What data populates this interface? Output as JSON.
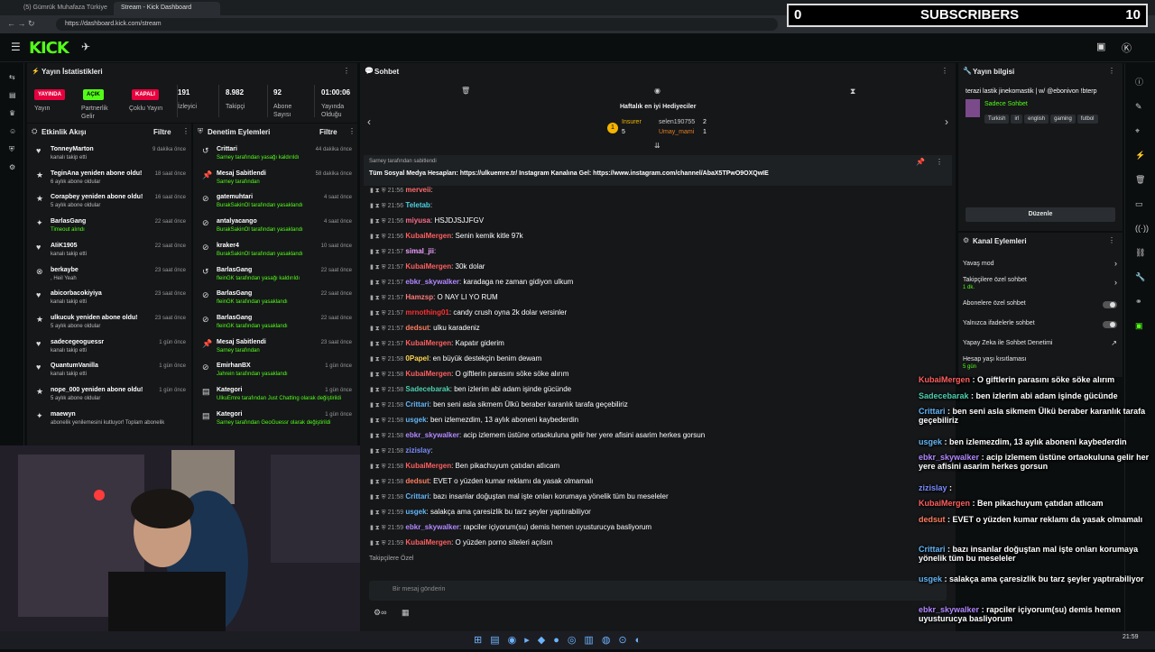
{
  "browser": {
    "tabs": [
      "(5) Gümrük Muhafaza Türkiye 10...",
      "Stream - Kick Dashboard"
    ],
    "url": "https://dashboard.kick.com/stream"
  },
  "overlay_subs": {
    "left": "0",
    "label": "SUBSCRIBERS",
    "right": "10"
  },
  "logo": "KICK",
  "stats": {
    "title": "Yayın İstatistikleri",
    "badges": [
      "YAYINDA",
      "AÇIK",
      "KAPALI"
    ],
    "badge_labels": [
      "Yayın",
      "Partnerlik Gelir",
      "Çoklu Yayın"
    ],
    "items": [
      {
        "value": "191",
        "label": "İzleyici"
      },
      {
        "value": "8.982",
        "label": "Takipçi"
      },
      {
        "value": "92",
        "label": "Abone Sayısı"
      },
      {
        "value": "01:00:06",
        "label": "Yayında Olduğu"
      }
    ]
  },
  "feed": {
    "title": "Etkinlik Akışı",
    "filter": "Filtre",
    "items": [
      {
        "name": "TonneyMarton",
        "sub": "kanalı takip etti",
        "time": "9 dakika önce"
      },
      {
        "name": "TeginAna yeniden abone oldu!",
        "sub": "6 aylık abone oldular",
        "time": "18 saat önce"
      },
      {
        "name": "Corapbey yeniden abone oldu!",
        "sub": "5 aylık abone oldular",
        "time": "16 saat önce"
      },
      {
        "name": "BarlasGang",
        "sub": "Timeout alındı",
        "time": "22 saat önce"
      },
      {
        "name": "AIiK1905",
        "sub": "kanalı takip etti",
        "time": "22 saat önce"
      },
      {
        "name": "berkaybe",
        "sub": ", Heil Yeah",
        "time": "23 saat önce"
      },
      {
        "name": "abicorbacokiyiya",
        "sub": "kanalı takip etti",
        "time": "23 saat önce"
      },
      {
        "name": "ulkucuk yeniden abone oldu!",
        "sub": "5 aylık abone oldular",
        "time": "23 saat önce"
      },
      {
        "name": "sadecegeoguessr",
        "sub": "kanalı takip etti",
        "time": "1 gün önce"
      },
      {
        "name": "QuantumVanilla",
        "sub": "kanalı takip etti",
        "time": "1 gün önce"
      },
      {
        "name": "nope_000 yeniden abone oldu!",
        "sub": "5 aylık abone oldular",
        "time": "1 gün önce"
      },
      {
        "name": "maewyn",
        "sub": "abonelik yenilemesini kutluyor! Toplam abonelik",
        "time": ""
      }
    ],
    "gift_sub": "gönderdi"
  },
  "mod": {
    "title": "Denetim Eylemleri",
    "filter": "Filtre",
    "items": [
      {
        "name": "Crittari",
        "sub": "Sarney tarafından yasağı kaldırıldı",
        "time": "44 dakika önce"
      },
      {
        "name": "Mesaj Sabitlendi",
        "sub": "Sarney tarafından",
        "time": "58 dakika önce"
      },
      {
        "name": "gatemuhtari",
        "sub": "BurakSakinOl tarafından yasaklandı",
        "time": "4 saat önce"
      },
      {
        "name": "antalyacango",
        "sub": "BurakSakinOl tarafından yasaklandı",
        "time": "4 saat önce"
      },
      {
        "name": "kraker4",
        "sub": "BurakSakinOl tarafından yasaklandı",
        "time": "10 saat önce"
      },
      {
        "name": "BarlasGang",
        "sub": "fleinGK tarafından yasağı kaldırıldı",
        "time": "22 saat önce"
      },
      {
        "name": "BarlasGang",
        "sub": "fleinGK tarafından yasaklandı",
        "time": "22 saat önce"
      },
      {
        "name": "BarlasGang",
        "sub": "fleinGK tarafından yasaklandı",
        "time": "22 saat önce"
      },
      {
        "name": "Mesaj Sabitlendi",
        "sub": "Sarney tarafından",
        "time": "23 saat önce"
      },
      {
        "name": "EmirhanBX",
        "sub": "Jahrein tarafından yasaklandı",
        "time": "1 gün önce"
      },
      {
        "name": "Kategori",
        "sub": "UlkuEmre tarafından Just Chatting olarak değiştirildi",
        "time": "1 gün önce"
      },
      {
        "name": "Kategori",
        "sub": "Sarney tarafından GeoGuessr olarak değiştirildi",
        "time": "1 gün önce"
      }
    ]
  },
  "chat": {
    "title": "Sohbet",
    "gifters_title": "Haftalık en iyi Hediyeciler",
    "gifters": [
      {
        "name": "Insurer",
        "count": "5"
      },
      {
        "name": "selen190755",
        "count": "2"
      },
      {
        "name": "Umay_mami",
        "count": "1"
      }
    ],
    "pinned_by": "Sarney tarafından sabitlendi",
    "pinned_text": "Tüm Sosyal Medya Hesapları: https://ulkuemre.tr/ Instagram Kanalına Gel: https://www.instagram.com/channel/AbaX5TPwO9OXQwIE",
    "messages": [
      {
        "time": "21:56",
        "user": "merveii",
        "color": "#ff6b6b",
        "text": ""
      },
      {
        "time": "21:56",
        "user": "Teletab",
        "color": "#4dd0e1",
        "text": ""
      },
      {
        "time": "21:56",
        "user": "miyusa",
        "color": "#ff6b8a",
        "text": "HSJDJSJJFGV"
      },
      {
        "time": "21:56",
        "user": "KubaiMergen",
        "color": "#ff5f5f",
        "text": "Senin kemik kitle 97k"
      },
      {
        "time": "21:57",
        "user": "simal_jii",
        "color": "#f0a0ff",
        "text": ""
      },
      {
        "time": "21:57",
        "user": "KubaiMergen",
        "color": "#ff5f5f",
        "text": "30k dolar"
      },
      {
        "time": "21:57",
        "user": "ebkr_skywalker",
        "color": "#b388ff",
        "text": "karadaga ne zaman gidiyon ulkum"
      },
      {
        "time": "21:57",
        "user": "Hamzsp",
        "color": "#ff7b7b",
        "text": "O NAY LI YO RUM"
      },
      {
        "time": "21:57",
        "user": "mrnothing01",
        "color": "#ff3030",
        "text": "candy crush oyna 2k dolar versinler"
      },
      {
        "time": "21:57",
        "user": "dedsut",
        "color": "#ff7e5f",
        "text": "ulku karadeniz"
      },
      {
        "time": "21:57",
        "user": "KubaiMergen",
        "color": "#ff5f5f",
        "text": "Kapatır giderim"
      },
      {
        "time": "21:58",
        "user": "0Papel",
        "color": "#ffd54f",
        "text": "en büyük destekçin benim dewam"
      },
      {
        "time": "21:58",
        "user": "KubaiMergen",
        "color": "#ff5f5f",
        "text": "O giftlerin parasını söke söke alırım"
      },
      {
        "time": "21:58",
        "user": "Sadecebarak",
        "color": "#4dd0b0",
        "text": "ben izlerim abi adam işinde gücünde"
      },
      {
        "time": "21:58",
        "user": "Crittari",
        "color": "#64b5f6",
        "text": "ben seni asla sikmem Ülkü beraber karanlık tarafa geçebiliriz"
      },
      {
        "time": "21:58",
        "user": "usgek",
        "color": "#64b5f6",
        "text": "ben izlemezdim, 13 aylık aboneni kaybederdin"
      },
      {
        "time": "21:58",
        "user": "ebkr_skywalker",
        "color": "#b388ff",
        "text": "acip izlemem üstüne ortaokuluna gelir her yere afisini asarim herkes gorsun"
      },
      {
        "time": "21:58",
        "user": "zizislay",
        "color": "#7b8cff",
        "text": ""
      },
      {
        "time": "21:58",
        "user": "KubaiMergen",
        "color": "#ff5f5f",
        "text": "Ben pikachuyum çatıdan atlıcam"
      },
      {
        "time": "21:58",
        "user": "dedsut",
        "color": "#ff7e5f",
        "text": "EVET o yüzden kumar reklamı da yasak olmamalı"
      },
      {
        "time": "21:58",
        "user": "Crittari",
        "color": "#64b5f6",
        "text": "bazı insanlar doğuştan mal işte onları korumaya yönelik tüm bu meseleler"
      },
      {
        "time": "21:59",
        "user": "usgek",
        "color": "#64b5f6",
        "text": "salakça ama çaresizlik bu tarz şeyler yaptırabiliyor"
      },
      {
        "time": "21:59",
        "user": "ebkr_skywalker",
        "color": "#b388ff",
        "text": "rapciler içiyorum(su) demis hemen uyusturucya basliyorum"
      },
      {
        "time": "21:59",
        "user": "KubaiMergen",
        "color": "#ff5f5f",
        "text": "O yüzden porno siteleri açılsın"
      }
    ],
    "followers_only": "Takipçilere Özel",
    "input_placeholder": "Bir mesaj gönderin"
  },
  "stream_info": {
    "title": "Yayın bilgisi",
    "stream_title": "terazi lastik jinekomastik | w/ @ebonivon !bterp",
    "category": "Sadece Sohbet",
    "tags": [
      "Turkish",
      "irl",
      "english",
      "gaming",
      "futbol"
    ],
    "edit": "Düzenle"
  },
  "channel_actions": {
    "title": "Kanal Eylemleri",
    "items": [
      {
        "label": "Yavaş mod",
        "sub": ""
      },
      {
        "label": "Takipçilere özel sohbet",
        "sub": "1 dk."
      },
      {
        "label": "Abonelere özel sohbet",
        "sub": ""
      },
      {
        "label": "Yalnızca ifadelerle sohbet",
        "sub": ""
      },
      {
        "label": "Yapay Zeka ile Sohbet Denetimi",
        "sub": ""
      },
      {
        "label": "Hesap yaşı kısıtlaması",
        "sub": "5 gün"
      }
    ]
  },
  "overlay_chat": [
    {
      "user": "KubaiMergen",
      "color": "#ff5f5f",
      "text": "O giftlerin parasını söke söke alırım"
    },
    {
      "user": "Sadecebarak",
      "color": "#4dd0b0",
      "text": "ben izlerim abi adam işinde gücünde"
    },
    {
      "user": "Crittari",
      "color": "#64b5f6",
      "text": "ben seni asla sikmem Ülkü beraber karanlık tarafa geçebiliriz"
    },
    {
      "user": "usgek",
      "color": "#64b5f6",
      "text": "ben izlemezdim, 13 aylık aboneni kaybederdin"
    },
    {
      "user": "ebkr_skywalker",
      "color": "#b388ff",
      "text": "acip izlemem üstüne ortaokuluna gelir her yere afisini asarim herkes gorsun"
    },
    {
      "user": "zizislay",
      "color": "#7b8cff",
      "text": ""
    },
    {
      "user": "KubaiMergen",
      "color": "#ff5f5f",
      "text": "Ben pikachuyum çatıdan atlıcam"
    },
    {
      "user": "dedsut",
      "color": "#ff7e5f",
      "text": "EVET o yüzden kumar reklamı da yasak olmamalı"
    },
    {
      "user": "Crittari",
      "color": "#64b5f6",
      "text": "bazı insanlar doğuştan mal işte onları korumaya yönelik tüm bu meseleler"
    },
    {
      "user": "usgek",
      "color": "#64b5f6",
      "text": "salakça ama çaresizlik bu tarz şeyler yaptırabiliyor"
    },
    {
      "user": "ebkr_skywalker",
      "color": "#b388ff",
      "text": "rapciler içiyorum(su) demis hemen uyusturucya basliyorum"
    },
    {
      "user": "KubaiMergen",
      "color": "#ff5f5f",
      "text": "O yüzden porno siteleri açılsın"
    }
  ],
  "clock": {
    "time": "21:59"
  }
}
